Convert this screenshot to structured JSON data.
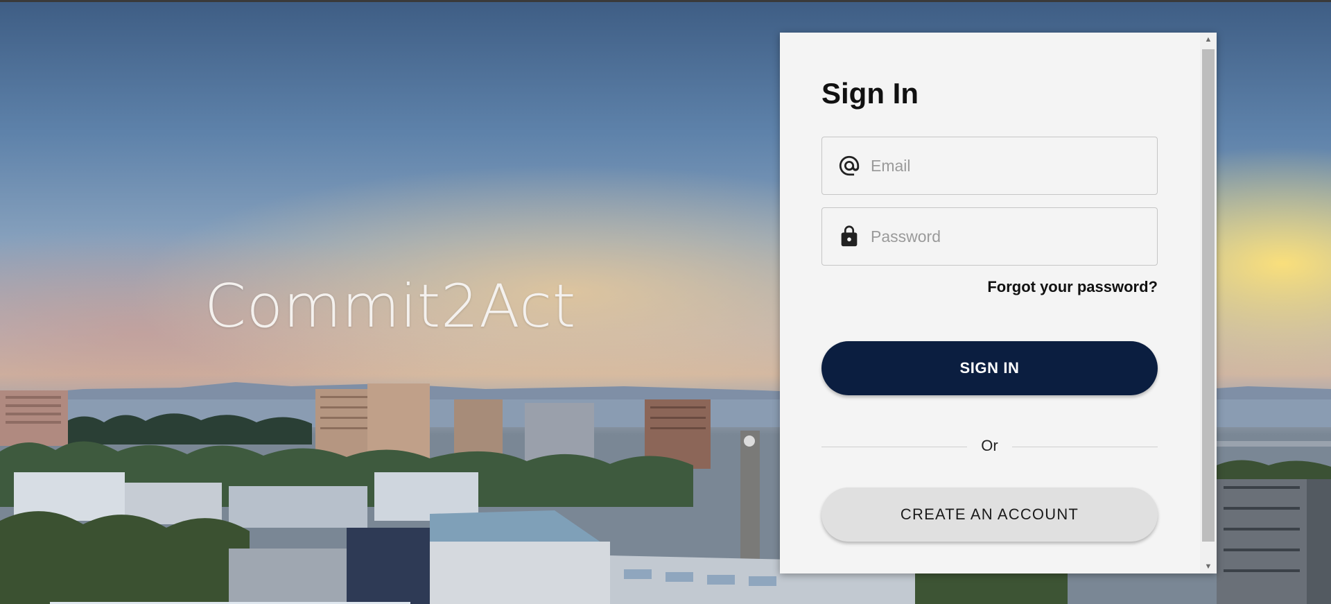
{
  "brand": {
    "title": "Commit2Act"
  },
  "signin": {
    "title": "Sign In",
    "email": {
      "placeholder": "Email",
      "value": "",
      "icon": "at-sign-icon"
    },
    "password": {
      "placeholder": "Password",
      "value": "",
      "icon": "lock-icon"
    },
    "forgot_label": "Forgot your password?",
    "signin_label": "SIGN IN",
    "divider_label": "Or",
    "create_label": "CREATE AN ACCOUNT"
  },
  "colors": {
    "primary_button": "#0b1e40",
    "secondary_button": "#e0e0e0",
    "card_background": "#f4f4f4"
  }
}
